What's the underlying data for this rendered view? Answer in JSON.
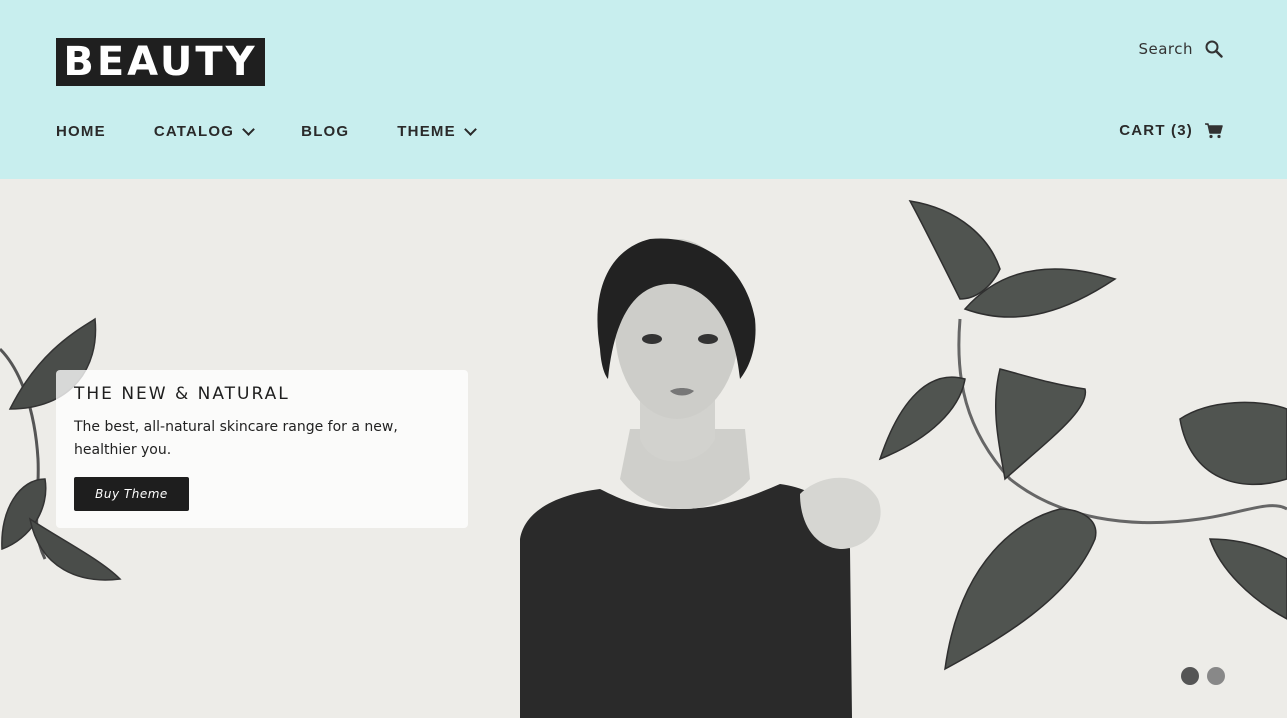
{
  "header": {
    "logo_text": "BEAUTY",
    "search_label": "Search",
    "nav": [
      {
        "label": "HOME"
      },
      {
        "label": "CATALOG"
      },
      {
        "label": "BLOG"
      },
      {
        "label": "THEME"
      }
    ],
    "cart_label": "CART (3)"
  },
  "hero": {
    "title": "THE NEW & NATURAL",
    "description": "The best, all-natural skincare range for a new, healthier you.",
    "button_label": "Buy Theme",
    "slides_count": 2,
    "active_slide": 1
  },
  "colors": {
    "header_bg": "#c8eeee",
    "hero_bg": "#edece8",
    "button_bg": "#1e1e1e"
  }
}
